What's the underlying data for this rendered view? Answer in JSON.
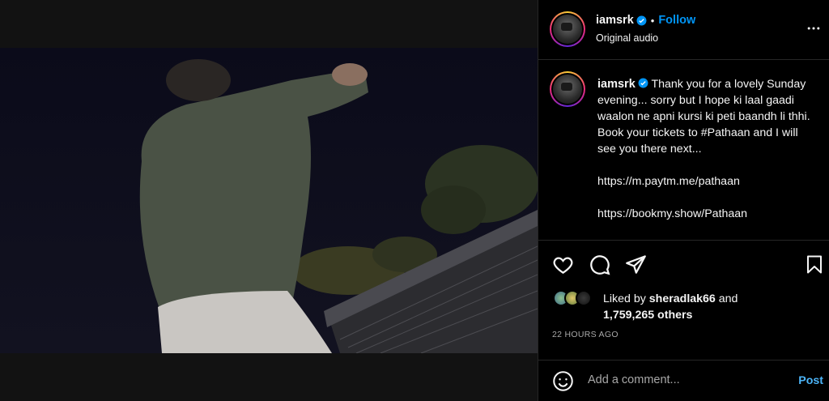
{
  "post": {
    "username": "iamsrk",
    "follow_label": "Follow",
    "subtitle": "Original audio",
    "caption": "Thank you for a lovely Sunday evening... sorry but I hope ki laal gaadi waalon ne apni kursi ki peti baandh li thhi.\nBook your tickets to #Pathaan and I will see you there next...\n\nhttps://m.paytm.me/pathaan\n\nhttps://bookmy.show/Pathaan",
    "likes_prefix": "Liked by ",
    "liked_by": "sheradlak66",
    "likes_and": " and",
    "likes_count": "1,759,265 others",
    "timestamp": "22 HOURS AGO"
  },
  "comment": {
    "placeholder": "Add a comment...",
    "post_label": "Post"
  },
  "icons": {
    "verified": "verified-badge-icon",
    "more": "more-options-icon",
    "like": "heart-icon",
    "comment": "comment-bubble-icon",
    "share": "paper-plane-icon",
    "save": "bookmark-icon",
    "emoji": "emoji-smiley-icon",
    "mute": "speaker-muted-icon"
  },
  "colors": {
    "accent": "#0095f6",
    "post_button": "#4cb5f9",
    "background": "#000000",
    "secondary_text": "#a8a8a8"
  }
}
